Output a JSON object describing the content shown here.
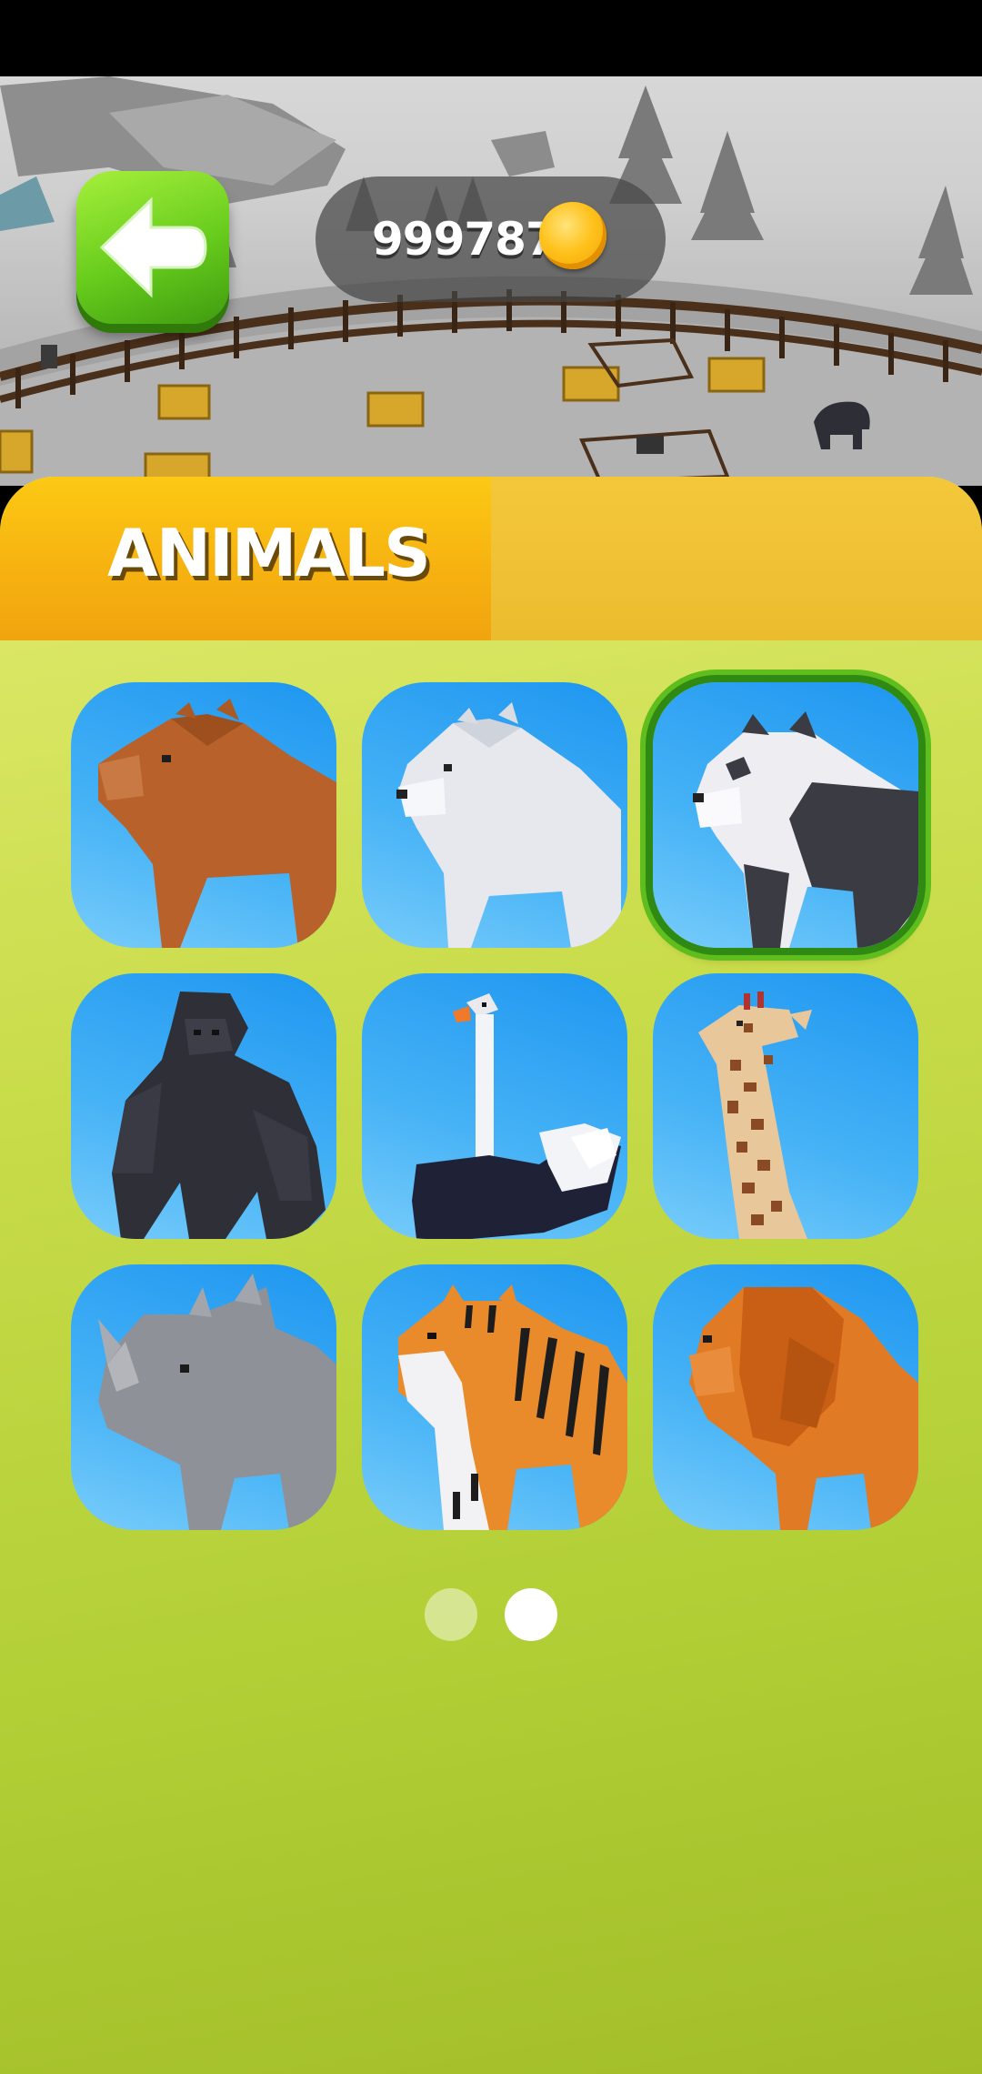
{
  "header": {
    "coins": "9997879"
  },
  "tabs": [
    {
      "label": "ANIMALS",
      "active": true
    },
    {
      "label": "",
      "active": false
    }
  ],
  "animals": [
    {
      "name": "bear",
      "selected": false
    },
    {
      "name": "polar-bear",
      "selected": false
    },
    {
      "name": "panda",
      "selected": true
    },
    {
      "name": "gorilla",
      "selected": false
    },
    {
      "name": "ostrich",
      "selected": false
    },
    {
      "name": "giraffe",
      "selected": false
    },
    {
      "name": "rhino",
      "selected": false
    },
    {
      "name": "tiger",
      "selected": false
    },
    {
      "name": "lion",
      "selected": false
    }
  ],
  "pagination": {
    "pages": 2,
    "current": 2
  },
  "colors": {
    "accent_green": "#67cc1c",
    "tab_orange": "#f6b110",
    "panel_green": "#c9dc4a",
    "tile_blue": "#47b3f6"
  }
}
